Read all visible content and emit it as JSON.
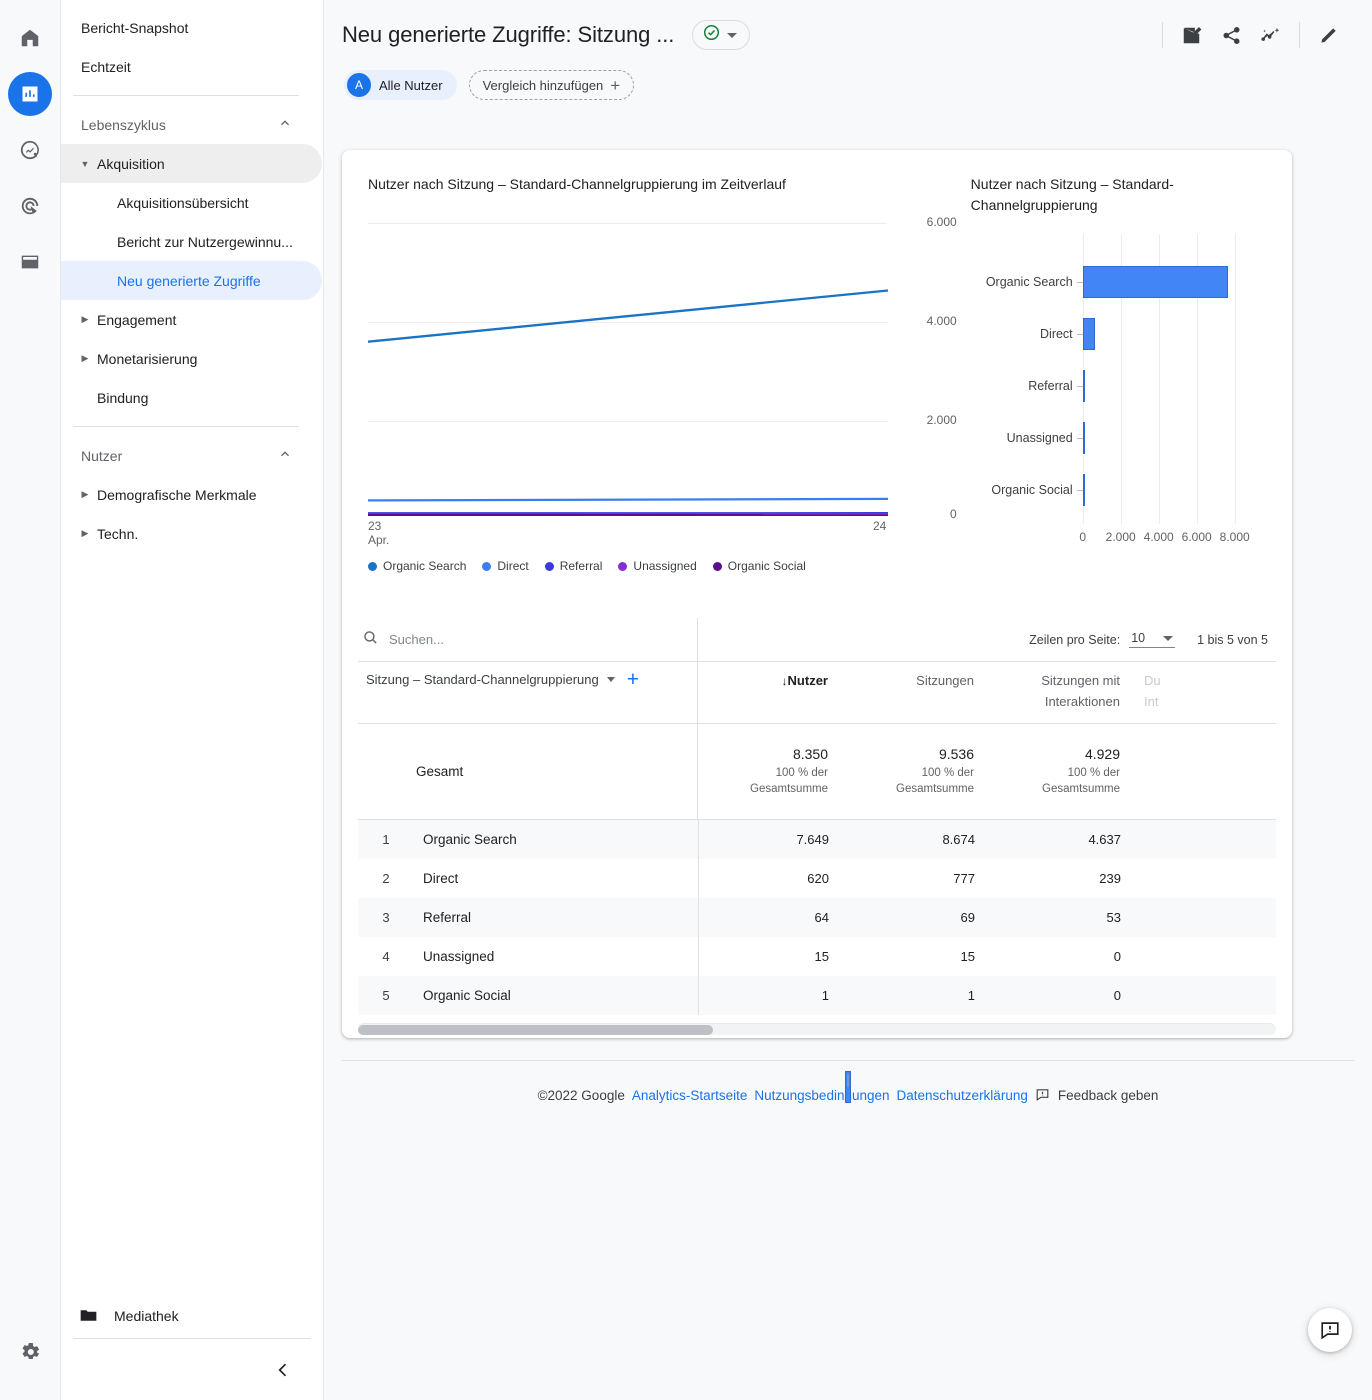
{
  "rail": {
    "items": [
      {
        "name": "home-icon",
        "label": "Startseite",
        "active": false
      },
      {
        "name": "reports-icon",
        "label": "Berichte",
        "active": true
      },
      {
        "name": "explore-icon",
        "label": "Explorative Datenanalyse",
        "active": false
      },
      {
        "name": "advertising-icon",
        "label": "Werbung",
        "active": false
      },
      {
        "name": "configure-icon",
        "label": "Konfigurieren",
        "active": false
      }
    ],
    "settings_label": "Verwaltung"
  },
  "sidebar": {
    "top_items": [
      {
        "label": "Bericht-Snapshot"
      },
      {
        "label": "Echtzeit"
      }
    ],
    "sections": [
      {
        "label": "Lebenszyklus",
        "groups": [
          {
            "label": "Akquisition",
            "expanded": true,
            "children": [
              {
                "label": "Akquisitionsübersicht",
                "selected": false
              },
              {
                "label": "Bericht zur Nutzergewinnu...",
                "selected": false
              },
              {
                "label": "Neu generierte Zugriffe",
                "selected": true
              }
            ]
          },
          {
            "label": "Engagement",
            "expanded": false,
            "children": []
          },
          {
            "label": "Monetarisierung",
            "expanded": false,
            "children": []
          }
        ],
        "plain_items": [
          {
            "label": "Bindung"
          }
        ]
      },
      {
        "label": "Nutzer",
        "groups": [
          {
            "label": "Demografische Merkmale",
            "expanded": false,
            "children": []
          },
          {
            "label": "Techn.",
            "expanded": false,
            "children": []
          }
        ],
        "plain_items": []
      }
    ],
    "library_label": "Mediathek",
    "collapse_label": "Navigation minimieren"
  },
  "header": {
    "title": "Neu generierte Zugriffe: Sitzung ...",
    "status_icon": "check-circle-icon",
    "tools": [
      {
        "name": "report-edit-icon",
        "label": "Bericht anpassen"
      },
      {
        "name": "share-icon",
        "label": "Diesen Bericht teilen"
      },
      {
        "name": "insights-icon",
        "label": "Statistiken"
      },
      {
        "name": "pencil-icon",
        "label": "Bearbeiten"
      }
    ],
    "audience_chip": {
      "initial": "A",
      "label": "Alle Nutzer"
    },
    "compare_chip": {
      "label": "Vergleich hinzufügen",
      "icon": "plus-icon"
    }
  },
  "chart_data": [
    {
      "type": "line",
      "title": "Nutzer nach Sitzung – Standard-Channelgruppierung im Zeitverlauf",
      "xlabel": "",
      "ylabel": "",
      "x": [
        "23",
        "24"
      ],
      "x_tick_sub": [
        "Apr.",
        ""
      ],
      "ylim": [
        0,
        6000
      ],
      "yticks": [
        0,
        2000,
        4000,
        6000
      ],
      "ytick_labels": [
        "0",
        "2.000",
        "4.000",
        "6.000"
      ],
      "grid": true,
      "legend_position": "bottom",
      "series": [
        {
          "name": "Organic Search",
          "color": "#1a73c4",
          "values": [
            3580,
            4630
          ]
        },
        {
          "name": "Direct",
          "color": "#3a7ef0",
          "values": [
            300,
            330
          ]
        },
        {
          "name": "Referral",
          "color": "#3b3bdb",
          "values": [
            35,
            36
          ]
        },
        {
          "name": "Unassigned",
          "color": "#8430ce",
          "values": [
            10,
            8
          ]
        },
        {
          "name": "Organic Social",
          "color": "#5b0f8b",
          "values": [
            1,
            0
          ]
        }
      ]
    },
    {
      "type": "bar",
      "title": "Nutzer nach Sitzung – Standard-Channelgruppierung",
      "orientation": "horizontal",
      "categories": [
        "Organic Search",
        "Direct",
        "Referral",
        "Unassigned",
        "Organic Social"
      ],
      "values": [
        7649,
        620,
        64,
        15,
        1
      ],
      "bar_color": "#4285f4",
      "xlim": [
        0,
        8800
      ],
      "xticks": [
        0,
        2000,
        4000,
        6000,
        8000
      ],
      "xtick_labels": [
        "0",
        "2.000",
        "4.000",
        "6.000",
        "8.000"
      ],
      "grid": true
    }
  ],
  "table": {
    "search_placeholder": "Suchen...",
    "search_value": "",
    "search_icon": "search-icon",
    "rows_per_page_label": "Zeilen pro Seite:",
    "rows_per_page_value": "10",
    "range_label": "1 bis 5 von 5",
    "dimension_label": "Sitzung – Standard-Channelgruppierung",
    "add_dimension_icon": "plus-icon",
    "columns": [
      {
        "label": "Nutzer",
        "sorted": true,
        "sort_indicator": "↓",
        "faded": false
      },
      {
        "label": "Sitzungen",
        "sorted": false,
        "faded": false
      },
      {
        "label": "Sitzungen mit Interaktionen",
        "sorted": false,
        "faded": false
      },
      {
        "label": "Du Int",
        "sorted": false,
        "faded": true
      }
    ],
    "total_row": {
      "label": "Gesamt",
      "cells": [
        {
          "value": "8.350",
          "sub": "100 % der Gesamtsumme"
        },
        {
          "value": "9.536",
          "sub": "100 % der Gesamtsumme"
        },
        {
          "value": "4.929",
          "sub": "100 % der Gesamtsumme"
        },
        {
          "value": "",
          "sub": ""
        }
      ]
    },
    "rows": [
      {
        "rank": "1",
        "name": "Organic Search",
        "cells": [
          "7.649",
          "8.674",
          "4.637",
          ""
        ]
      },
      {
        "rank": "2",
        "name": "Direct",
        "cells": [
          "620",
          "777",
          "239",
          ""
        ]
      },
      {
        "rank": "3",
        "name": "Referral",
        "cells": [
          "64",
          "69",
          "53",
          ""
        ]
      },
      {
        "rank": "4",
        "name": "Unassigned",
        "cells": [
          "15",
          "15",
          "0",
          ""
        ]
      },
      {
        "rank": "5",
        "name": "Organic Social",
        "cells": [
          "1",
          "1",
          "0",
          ""
        ]
      }
    ]
  },
  "footer": {
    "copyright": "©2022 Google",
    "links": [
      {
        "label": "Analytics-Startseite"
      },
      {
        "label": "Nutzungsbedingungen"
      },
      {
        "label": "Datenschutzerklärung"
      }
    ],
    "feedback_label": "Feedback geben",
    "feedback_icon": "feedback-icon",
    "separator": "|"
  },
  "fab": {
    "icon": "feedback-bubble-icon",
    "label": "Feedback"
  },
  "colors": {
    "accent": "#1a73e8",
    "bar": "#4285f4",
    "selected_bg": "#e8f0fe",
    "status_green": "#188038"
  }
}
